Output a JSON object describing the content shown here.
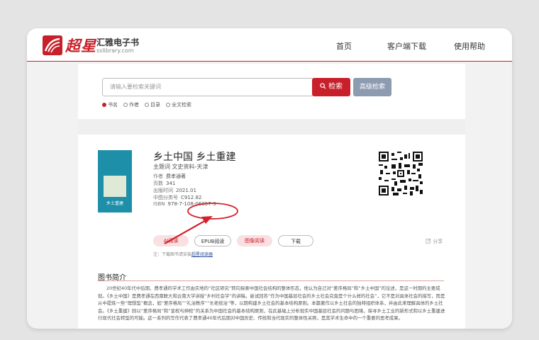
{
  "header": {
    "logo_text": "超星",
    "brand_name": "汇雅电子书",
    "brand_url": "sslibrary.com",
    "nav": [
      "首页",
      "客户端下载",
      "使用帮助"
    ]
  },
  "search": {
    "placeholder": "请输入要检索关键词",
    "search_label": "检索",
    "advanced_label": "高级检索",
    "options": [
      {
        "label": "书名",
        "selected": true
      },
      {
        "label": "作者",
        "selected": false
      },
      {
        "label": "目录",
        "selected": false
      },
      {
        "label": "全文检索",
        "selected": false
      }
    ]
  },
  "book": {
    "cover_text": "乡土重建",
    "title": "乡土中国 乡土重建",
    "subject": "主题词 文史资料-天津",
    "fields": [
      {
        "label": "作者",
        "value": "费孝通著"
      },
      {
        "label": "页数",
        "value": "341"
      },
      {
        "label": "出版时间",
        "value": "2021.01"
      },
      {
        "label": "中图分类号",
        "value": "C912.82"
      },
      {
        "label": "ISBN",
        "value": "978-7-108-06957-3"
      }
    ]
  },
  "actions": {
    "ai_read": "AI阅读",
    "epub_read": "EPUB阅读",
    "image_read": "图像阅读",
    "download": "下载",
    "share": "分享",
    "hint_prefix": "注：下载图书请安装",
    "hint_link": "超星阅读器"
  },
  "intro": {
    "title": "图书简介",
    "text": "20世纪40年代中后期，费孝通的学术工作由实地的“社区研究”转向探索中国社会结构的整体形态，他认为自己对“差序格局”和“乡土中国”的论述，是这一时期的主要成就。《乡土中国》是费孝通在西南联大和云南大学讲授“乡村社会学”的讲稿，尝试回答“作为中国基层社会的乡土社会究竟是个什么样的社会”，它不是对具体社会的描写，而是从中提炼一些“理想型”概念，如“差序格局”“礼治秩序”“长老统治”等，以期构建乡土社会的基本结构原则。本篇著作以乡土社会的独特组织体系，并由此来理解具体的乡土社会。《乡土重建》则以“差序格局”和“皇权与绅权”的关系为中国社会的基本结构原则，在此基础上分析现实中国基层社会的问题与困境，探寻乡土工业的新形式和以乡土重建进行现代社会转型的可能。这一系列的写作代表了费孝通40年代后期对中国历史、传统和当代现实的整体性关照，是其学术生命中的一个重要的思考成果。"
  },
  "colors": {
    "brand": "#c8202a",
    "advanced": "#8d9bb0",
    "pink": "#f9e0e2",
    "link": "#2a4fa0"
  }
}
